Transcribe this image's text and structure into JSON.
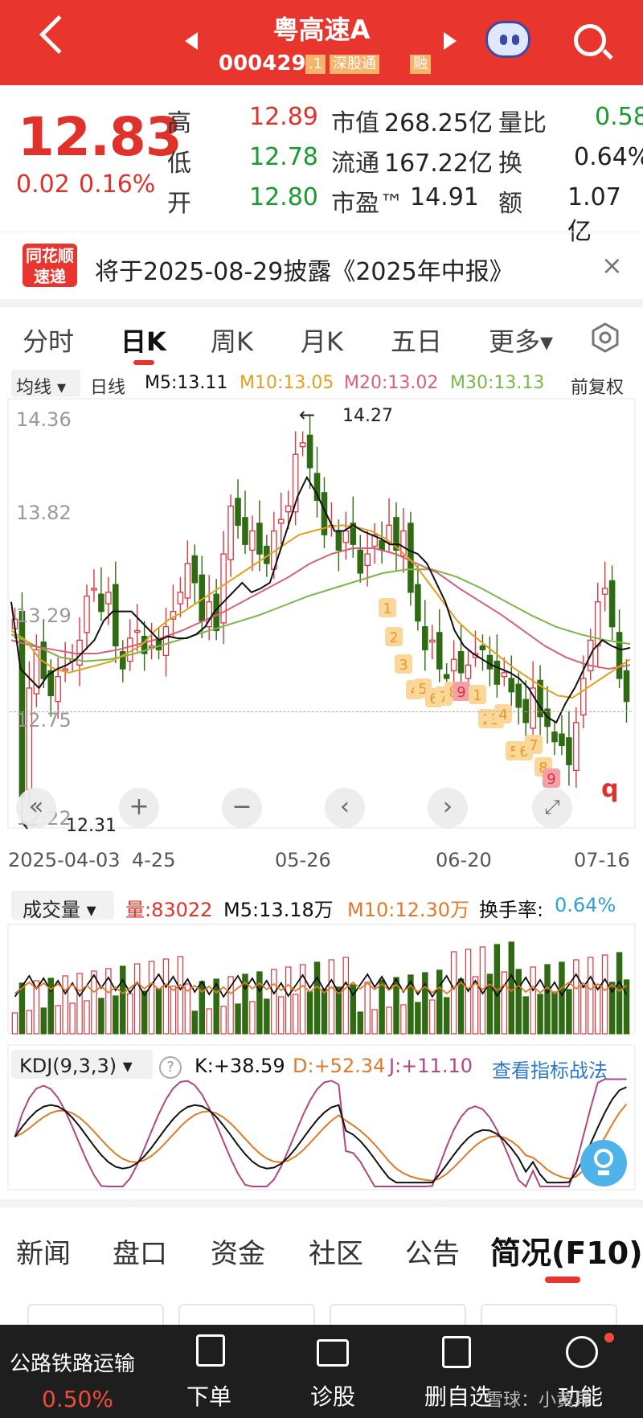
{
  "header": {
    "title": "粤高速A",
    "code": "000429",
    "tag1": ".1",
    "tag2": "深股通",
    "tag3": "融"
  },
  "quote": {
    "price": "12.83",
    "change": "0.02",
    "change_pct": "0.16%",
    "rows": [
      {
        "l1": "高",
        "v1": "12.89",
        "l2": "市值",
        "v2": "268.25亿",
        "l3": "量比",
        "v3": "0.58"
      },
      {
        "l1": "低",
        "v1": "12.78",
        "l2": "流通",
        "v2": "167.22亿",
        "l3": "换",
        "v3": "0.64%"
      },
      {
        "l1": "开",
        "v1": "12.80",
        "l2": "市盈™",
        "v2": "14.91",
        "l3": "额",
        "v3": "1.07亿"
      }
    ]
  },
  "notice": {
    "logo_line1": "同花顺",
    "logo_line2": "速递",
    "text": "将于2025-08-29披露《2025年中报》",
    "close": "×"
  },
  "period_tabs": [
    "分时",
    "日K",
    "周K",
    "月K",
    "五日",
    "更多▾"
  ],
  "ma_bar": {
    "selector": "均线 ▾",
    "type": "日线",
    "m5": "M5:13.11",
    "m10": "M10:13.05",
    "m20": "M20:13.02",
    "m30": "M30:13.13",
    "adjust": "前复权"
  },
  "colors": {
    "up": "#d9363e",
    "down": "#2e6b12",
    "m5": "#111111",
    "m10": "#e0a020",
    "m20": "#d9607a",
    "m30": "#7ab648",
    "accent": "#e8352e"
  },
  "chart_data": {
    "type": "candlestick",
    "y_ticks": [
      "14.36",
      "13.82",
      "13.29",
      "12.75",
      "12.22"
    ],
    "ylim": [
      12.22,
      14.36
    ],
    "high_marker": "14.27",
    "low_marker": "12.31",
    "x_labels": [
      "2025-04-03",
      "4-25",
      "05-26",
      "06-20",
      "07-16"
    ],
    "current_price_line": 12.83,
    "signal_numbers": [
      "1",
      "2",
      "3",
      "4",
      "5",
      "6",
      "7",
      "8",
      "9",
      "1",
      "2",
      "3",
      "4",
      "5",
      "6",
      "7",
      "8",
      "9"
    ],
    "end_marker": "q",
    "closes": [
      13.26,
      12.33,
      12.9,
      13.1,
      12.95,
      12.86,
      12.96,
      13.0,
      13.05,
      13.15,
      13.38,
      13.42,
      13.3,
      13.4,
      13.12,
      13.0,
      13.16,
      13.2,
      13.08,
      13.12,
      13.1,
      13.22,
      13.3,
      13.4,
      13.55,
      13.45,
      13.25,
      13.35,
      13.2,
      13.6,
      13.85,
      13.75,
      13.65,
      13.72,
      13.6,
      13.55,
      13.72,
      13.78,
      13.85,
      14.12,
      14.18,
      14.05,
      13.88,
      13.7,
      13.75,
      13.62,
      13.72,
      13.65,
      13.5,
      13.6,
      13.7,
      13.62,
      13.75,
      13.62,
      13.72,
      13.4,
      13.25,
      13.1,
      13.15,
      13.0,
      12.95,
      13.05,
      12.98,
      13.02,
      13.08,
      13.1,
      13.0,
      12.92,
      12.98,
      12.88,
      12.8,
      12.72,
      12.9,
      12.75,
      12.7,
      12.62,
      12.6,
      12.5,
      12.72,
      12.95,
      13.15,
      13.35,
      13.42,
      13.22,
      12.95,
      12.83
    ],
    "m5": [
      13.35,
      13.0,
      12.95,
      12.9,
      12.97,
      13.0,
      13.02,
      13.05,
      13.1,
      13.15,
      13.25,
      13.3,
      13.3,
      13.3,
      13.25,
      13.2,
      13.15,
      13.17,
      13.16,
      13.16,
      13.18,
      13.22,
      13.3,
      13.35,
      13.4,
      13.45,
      13.4,
      13.42,
      13.45,
      13.6,
      13.75,
      13.9,
      14.0,
      13.92,
      13.82,
      13.72,
      13.72,
      13.75,
      13.72,
      13.7,
      13.68,
      13.65,
      13.65,
      13.62,
      13.6,
      13.55,
      13.45,
      13.35,
      13.2,
      13.12,
      13.08,
      13.05,
      13.02,
      13.0,
      12.98,
      12.95,
      12.9,
      12.82,
      12.75,
      12.72,
      12.82,
      12.9,
      13.0,
      13.1,
      13.15,
      13.12,
      13.1,
      13.11
    ],
    "m10": [
      13.2,
      13.15,
      13.05,
      13.0,
      12.98,
      13.0,
      13.02,
      13.04,
      13.08,
      13.12,
      13.2,
      13.26,
      13.3,
      13.35,
      13.4,
      13.45,
      13.5,
      13.55,
      13.6,
      13.65,
      13.7,
      13.72,
      13.74,
      13.75,
      13.74,
      13.72,
      13.68,
      13.62,
      13.55,
      13.45,
      13.35,
      13.25,
      13.18,
      13.12,
      13.06,
      13.0,
      12.95,
      12.9,
      12.86,
      12.85,
      12.9,
      12.95,
      13.0,
      13.05
    ],
    "m20": [
      13.15,
      13.12,
      13.1,
      13.08,
      13.08,
      13.1,
      13.13,
      13.16,
      13.2,
      13.25,
      13.3,
      13.36,
      13.42,
      13.48,
      13.55,
      13.6,
      13.63,
      13.63,
      13.6,
      13.55,
      13.5,
      13.42,
      13.35,
      13.28,
      13.2,
      13.12,
      13.06,
      13.02,
      13.0,
      13.02
    ],
    "m30": [
      13.18,
      13.12,
      13.06,
      13.04,
      13.05,
      13.08,
      13.12,
      13.16,
      13.2,
      13.24,
      13.28,
      13.33,
      13.38,
      13.42,
      13.46,
      13.5,
      13.52,
      13.52,
      13.48,
      13.42,
      13.35,
      13.28,
      13.22,
      13.18,
      13.15,
      13.13
    ]
  },
  "volume_bar": {
    "selector": "成交量 ▾",
    "vol": "量:83022",
    "m5": "M5:13.18万",
    "m10": "M10:12.30万",
    "turnover_label": "换手率:",
    "turnover": "0.64%"
  },
  "kdj_bar": {
    "selector": "KDJ(9,3,3) ▾",
    "help": "?",
    "k": "K:+38.59",
    "d": "D:+52.34",
    "j": "J:+11.10",
    "link": "查看指标战法"
  },
  "bottom_tabs": [
    "新闻",
    "盘口",
    "资金",
    "社区",
    "公告",
    "简况(F10)"
  ],
  "bottom_nav": {
    "sector": "公路铁路运输",
    "sector_pct": "0.50%",
    "items": [
      "下单",
      "诊股",
      "删自选",
      "功能"
    ],
    "watermark": "雪球：小黄异"
  }
}
